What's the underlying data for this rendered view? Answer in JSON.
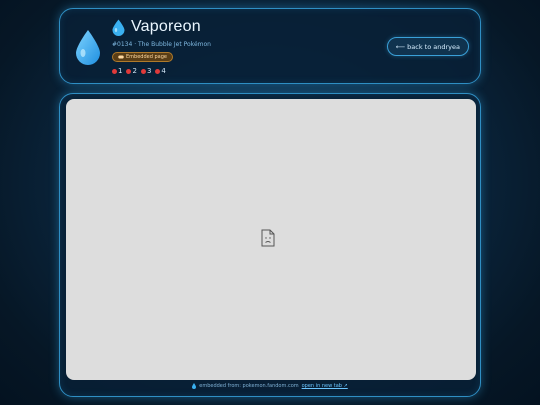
{
  "header": {
    "title": "Vaporeon",
    "subtitle": "#0134 · The Bubble Jet Pokémon",
    "badge": "Embedded page",
    "badge_icon": "gamepad-icon",
    "pokeballs": [
      "1",
      "2",
      "3",
      "4"
    ],
    "back_label": "⟵ back to andryea"
  },
  "embed": {
    "state": "broken-document-icon"
  },
  "footer": {
    "source_text": "embedded from: pokemon.fandom.com",
    "open_link": "open in new tab ↗"
  },
  "colors": {
    "accent": "#2f8fc4",
    "drop": "#3ab0f0",
    "background": "#0b2740"
  }
}
